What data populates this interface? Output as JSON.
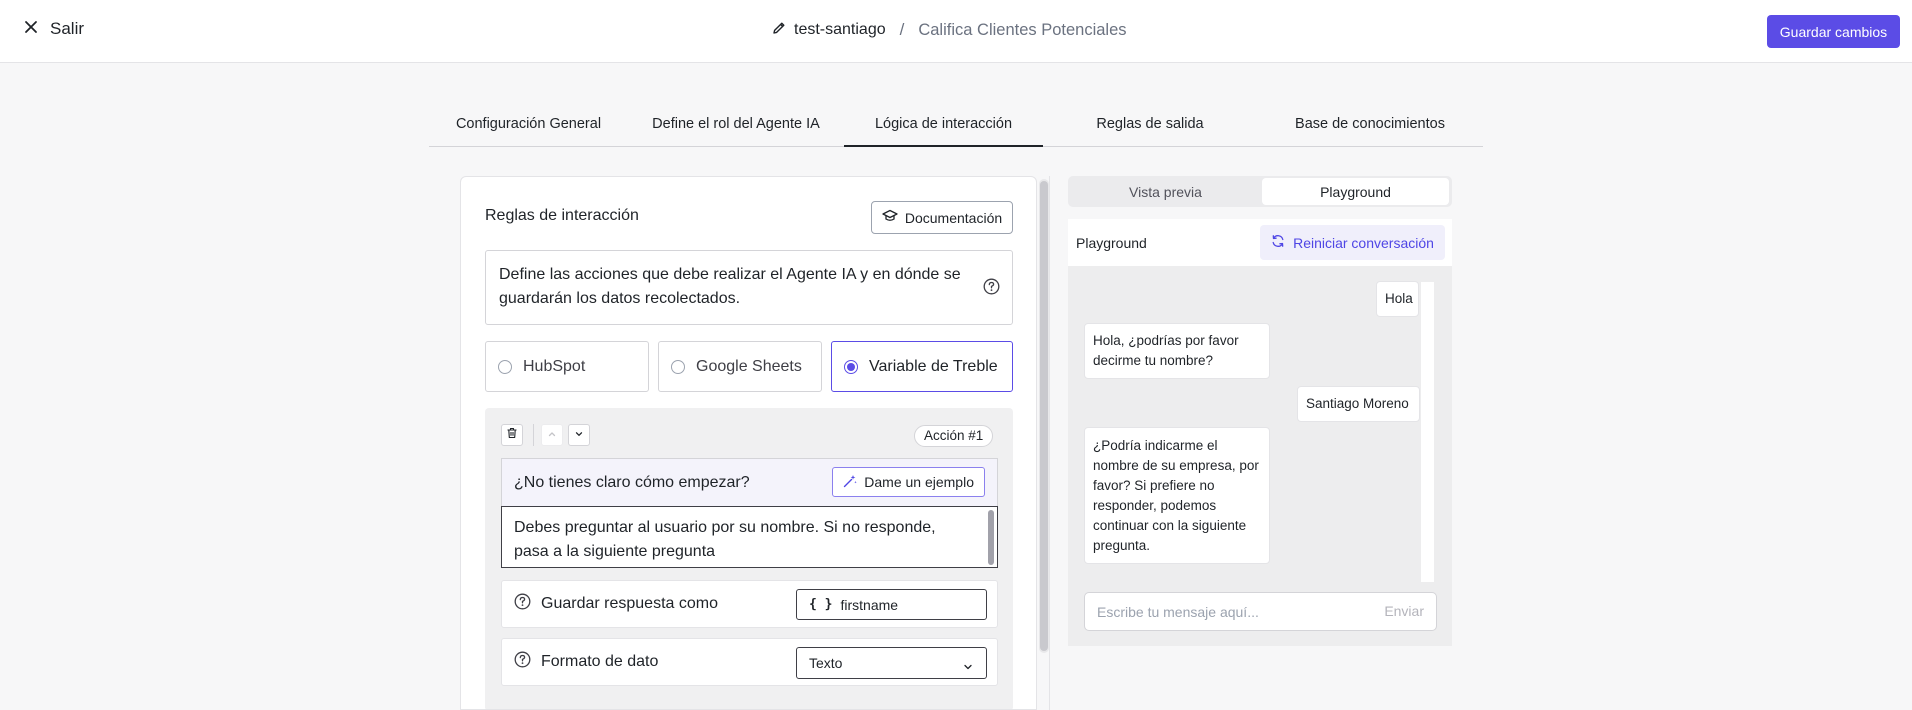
{
  "header": {
    "exit_label": "Salir",
    "agent_name": "test-santiago",
    "separator": "/",
    "page_title": "Califica Clientes Potenciales",
    "save_label": "Guardar cambios"
  },
  "tabs": [
    {
      "label": "Configuración General",
      "active": false
    },
    {
      "label": "Define el rol del Agente IA",
      "active": false
    },
    {
      "label": "Lógica de interacción",
      "active": true
    },
    {
      "label": "Reglas de salida",
      "active": false
    },
    {
      "label": "Base de conocimientos",
      "active": false
    }
  ],
  "rules": {
    "title": "Reglas de interacción",
    "doc_button": "Documentación",
    "description": "Define las acciones que debe realizar el Agente IA y en dónde se guardarán los datos recolectados.",
    "options": [
      {
        "label": "HubSpot",
        "selected": false
      },
      {
        "label": "Google Sheets",
        "selected": false
      },
      {
        "label": "Variable de Treble",
        "selected": true
      }
    ]
  },
  "action": {
    "badge": "Acción #1",
    "hint": "¿No tienes claro cómo empezar?",
    "example_button": "Dame un ejemplo",
    "prompt": "Debes preguntar al usuario por su nombre. Si no responde, pasa a la siguiente pregunta",
    "save_as_label": "Guardar respuesta como",
    "save_as_value": "firstname",
    "format_label": "Formato de dato",
    "format_value": "Texto"
  },
  "preview": {
    "seg_preview": "Vista previa",
    "seg_playground": "Playground",
    "header_title": "Playground",
    "restart_label": "Reiniciar conversación",
    "messages": [
      {
        "from": "user",
        "text": "Hola"
      },
      {
        "from": "agent",
        "text": "Hola, ¿podrías por favor decirme tu nombre?"
      },
      {
        "from": "user",
        "text": "Santiago Moreno"
      },
      {
        "from": "agent",
        "text": "¿Podría indicarme el nombre de su empresa, por favor? Si prefiere no responder, podemos continuar con la siguiente pregunta."
      }
    ],
    "input_placeholder": "Escribe tu mensaje aquí...",
    "send_label": "Enviar"
  },
  "colors": {
    "accent": "#5b4ce6",
    "link": "#4f46e5"
  }
}
